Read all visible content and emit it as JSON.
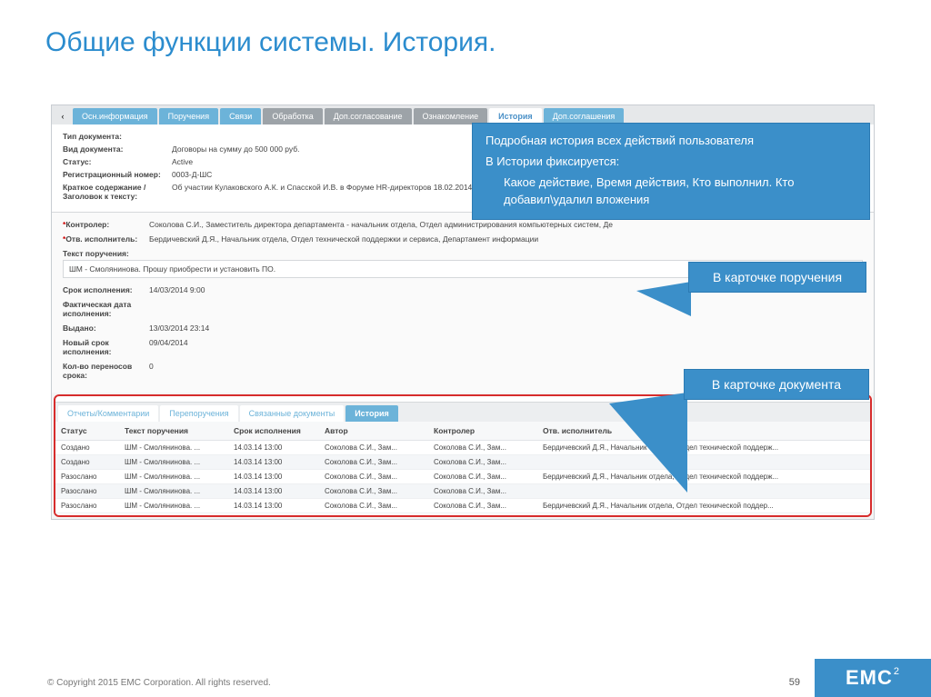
{
  "slide": {
    "title": "Общие функции системы. История.",
    "copyright": "© Copyright 2015 EMC Corporation. All rights reserved.",
    "page_number": "59",
    "logo": "EMC",
    "logo_exp": "2"
  },
  "callouts": {
    "main_l1": "Подробная история всех действий пользователя",
    "main_l2": "В Истории фиксируется:",
    "main_l3": "Какое действие, Время действия, Кто выполнил. Кто добавил\\удалил вложения",
    "task": "В карточке поручения",
    "doc": "В карточке документа"
  },
  "tabs": [
    "Осн.информация",
    "Поручения",
    "Связи",
    "Обработка",
    "Доп.согласование",
    "Ознакомление",
    "История",
    "Доп.соглашения"
  ],
  "info": {
    "type_label": "Тип документа:",
    "type_value": "",
    "kind_label": "Вид документа:",
    "kind_value": "Договоры на сумму до 500 000 руб.",
    "status_label": "Статус:",
    "status_value": "Active",
    "regnum_label": "Регистрационный номер:",
    "regnum_value": "0003-Д-ШС",
    "summary_label": "Краткое содержание / Заголовок к тексту:",
    "summary_value": "Об участии Кулаковского А.К. и Спасской И.В. в Форуме HR-директоров 18.02.2014"
  },
  "details": {
    "controller_label": "Контролер:",
    "controller_value": "Соколова С.И., Заместитель директора департамента - начальник отдела, Отдел администрирования компьютерных систем, Де",
    "executor_label": "Отв. исполнитель:",
    "executor_value": "Бердичевский Д.Я., Начальник отдела, Отдел технической поддержки и сервиса, Департамент информации",
    "text_label": "Текст поручения:",
    "text_value": "ШМ - Смолянинова. Прошу приобрести и установить ПО.",
    "due_label": "Срок исполнения:",
    "due_value": "14/03/2014 9:00",
    "actual_label": "Фактическая дата исполнения:",
    "actual_value": "",
    "issued_label": "Выдано:",
    "issued_value": "13/03/2014 23:14",
    "newdue_label": "Новый срок исполнения:",
    "newdue_value": "09/04/2014",
    "moves_label": "Кол-во переносов срока:",
    "moves_value": "0"
  },
  "subtabs": [
    "Отчеты/Комментарии",
    "Перепоручения",
    "Связанные документы",
    "История"
  ],
  "table": {
    "headers": [
      "Статус",
      "Текст поручения",
      "Срок исполнения",
      "Автор",
      "Контролер",
      "Отв. исполнитель"
    ],
    "rows": [
      [
        "Создано",
        "ШМ - Смолянинова. ...",
        "14.03.14 13:00",
        "Соколова С.И., Зам...",
        "Соколова С.И., Зам...",
        "Бердичевский Д.Я., Начальник отдела, Отдел технической поддерж..."
      ],
      [
        "Создано",
        "ШМ - Смолянинова. ...",
        "14.03.14 13:00",
        "Соколова С.И., Зам...",
        "Соколова С.И., Зам...",
        ""
      ],
      [
        "Разослано",
        "ШМ - Смолянинова. ...",
        "14.03.14 13:00",
        "Соколова С.И., Зам...",
        "Соколова С.И., Зам...",
        "Бердичевский Д.Я., Начальник отдела, Отдел технической поддерж..."
      ],
      [
        "Разослано",
        "ШМ - Смолянинова. ...",
        "14.03.14 13:00",
        "Соколова С.И., Зам...",
        "Соколова С.И., Зам...",
        ""
      ],
      [
        "Разослано",
        "ШМ - Смолянинова. ...",
        "14.03.14 13:00",
        "Соколова С.И., Зам...",
        "Соколова С.И., Зам...",
        "Бердичевский Д.Я., Начальник отдела, Отдел технической поддер..."
      ]
    ]
  }
}
